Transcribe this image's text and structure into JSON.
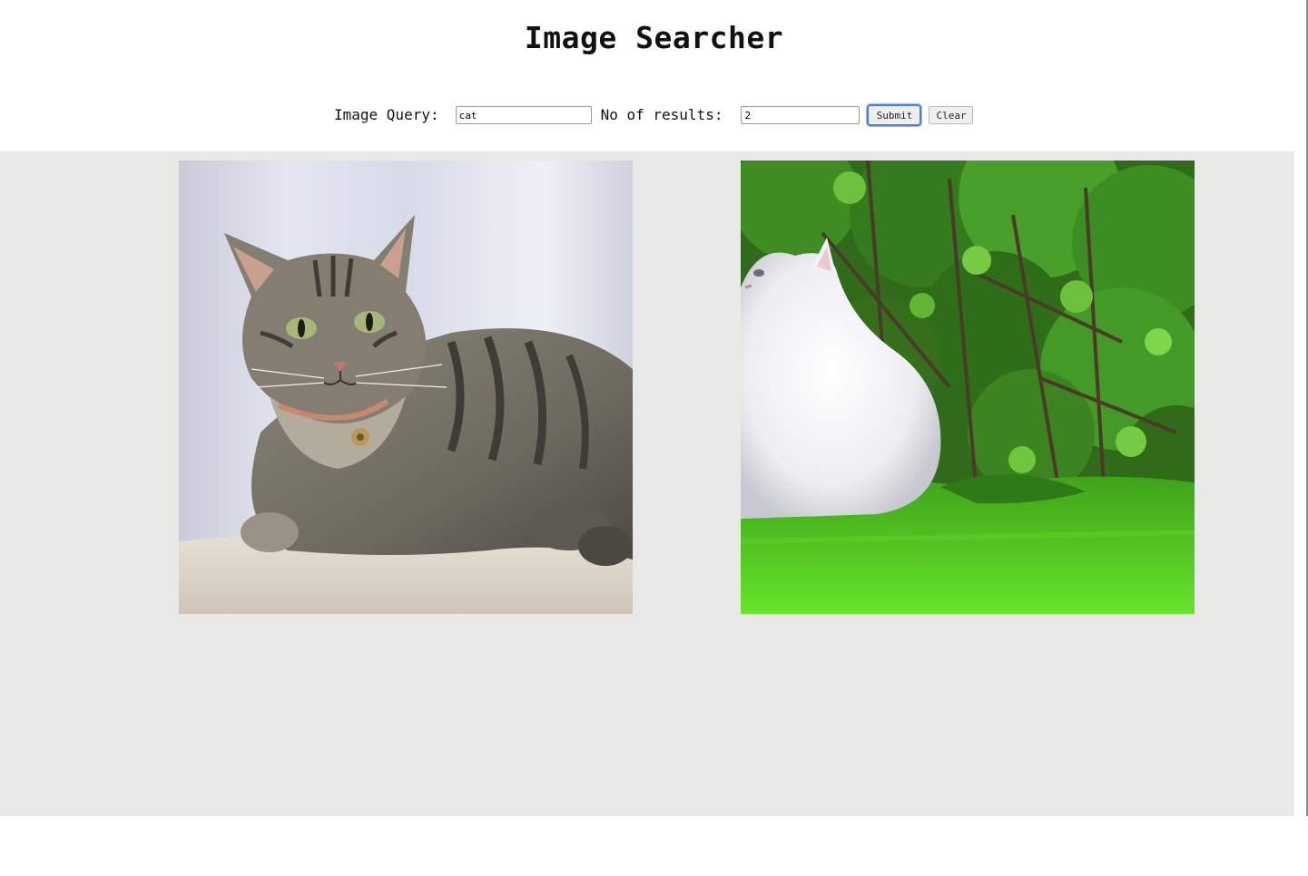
{
  "header": {
    "title": "Image Searcher"
  },
  "search": {
    "query_label": "Image Query:",
    "query_value": "cat",
    "count_label": "No of results:",
    "count_value": "2",
    "submit_label": "Submit",
    "clear_label": "Clear"
  },
  "results": [
    {
      "name": "tabby-cat-photo",
      "subject": "tabby cat"
    },
    {
      "name": "white-cat-photo",
      "subject": "white cat"
    }
  ],
  "colors": {
    "panel_bg": "#e8e9e6",
    "focus_ring": "#4a7fe0"
  }
}
